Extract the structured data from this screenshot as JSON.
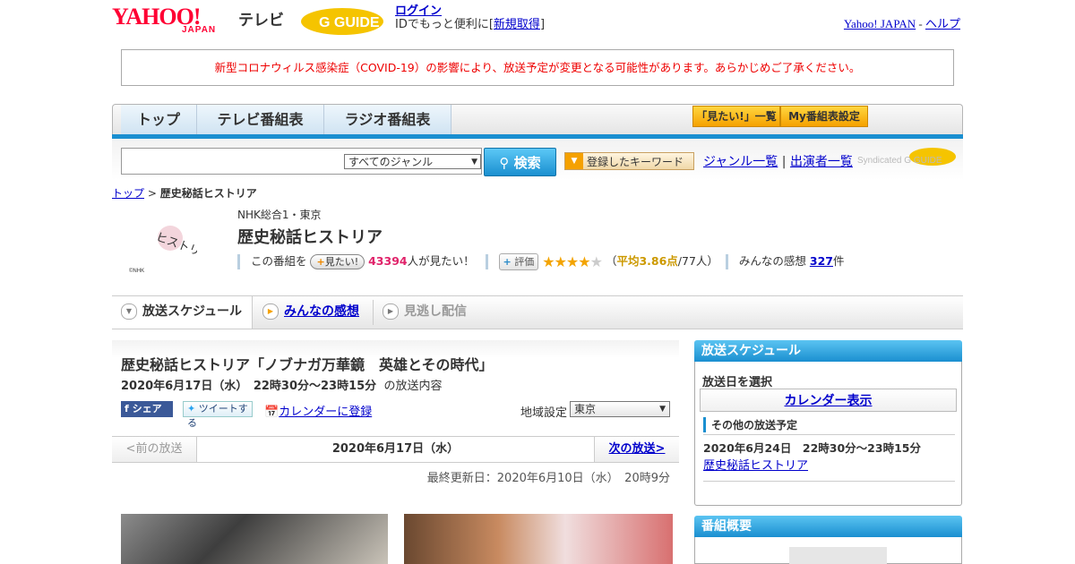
{
  "header": {
    "logo_text": "YAHOO!",
    "logo_sub": "JAPAN",
    "service": "テレビ",
    "gguide_logo": "G GUIDE",
    "login": "ログイン",
    "login_sub_prefix": "IDでもっと便利に[",
    "register": "新規取得",
    "login_sub_suffix": "]",
    "yahoo_link": "Yahoo! JAPAN",
    "help_link": "ヘルプ",
    "link_sep": " - "
  },
  "notice": "新型コロナウィルス感染症（COVID-19）の影響により、放送予定が変更となる可能性があります。あらかじめご了承ください。",
  "nav": {
    "tabs": [
      "トップ",
      "テレビ番組表",
      "ラジオ番組表"
    ],
    "mitai_list": "「見たい!」一覧",
    "my_settings": "My番組表設定"
  },
  "search": {
    "placeholder": "",
    "genre_selected": "すべてのジャンル",
    "button": "検索",
    "keyword_button": "登録したキーワード",
    "genre_list": "ジャンル一覧",
    "performer_list": "出演者一覧",
    "divider": "|",
    "syndicated": "Syndicated G GUIDE"
  },
  "breadcrumb": {
    "home": "トップ",
    "sep": " > ",
    "current": "歴史秘話ヒストリア"
  },
  "program": {
    "thumb_text": "ヒストリア",
    "thumb_credit": "©NHK",
    "station": "NHK総合1・東京",
    "title": "歴史秘話ヒストリア",
    "mitai_prefix": "この番組を",
    "mitai_badge_plus": "+",
    "mitai_badge": "見たい!",
    "mitai_count": "43394",
    "mitai_suffix": "人が見たい！",
    "rate_badge": "評価",
    "rating_avg": 3.86,
    "rating_text_open": "（",
    "rating_avg_label": "平均3.86点",
    "rating_count": "/77人",
    "rating_text_close": "）",
    "kanso_prefix": "みんなの感想",
    "kanso_count": "327",
    "kanso_suffix": "件"
  },
  "subtabs": {
    "schedule": "放送スケジュール",
    "kanso": "みんなの感想",
    "minogashi": "見逃し配信"
  },
  "episode": {
    "title": "歴史秘話ヒストリア「ノブナガ万華鏡　英雄とその時代」",
    "date": "2020年6月17日（水）　22時30分～23時15分",
    "date_suffix": "の放送内容",
    "share_fb": "シェア",
    "share_tw": "ツイートする",
    "calendar_register": "カレンダーに登録",
    "region_label": "地域設定",
    "region_selected": "東京",
    "prev": "<前の放送",
    "current_date": "2020年6月17日（水）",
    "next": "次の放送>",
    "updated": "最終更新日：2020年6月10日（水）　20時9分"
  },
  "sidebar": {
    "schedule_header": "放送スケジュール",
    "select_day": "放送日を選択",
    "calendar_button": "カレンダー表示",
    "other_header": "その他の放送予定",
    "other_date": "2020年6月24日　22時30分～23時15分",
    "other_link": "歴史秘話ヒストリア",
    "overview_header": "番組概要"
  },
  "colors": {
    "accent_blue": "#1a8fd0",
    "notice_red": "#e00000",
    "yahoo_red": "#ff0033",
    "mitai_pink": "#e0236a",
    "star_gold": "#f3a400"
  }
}
